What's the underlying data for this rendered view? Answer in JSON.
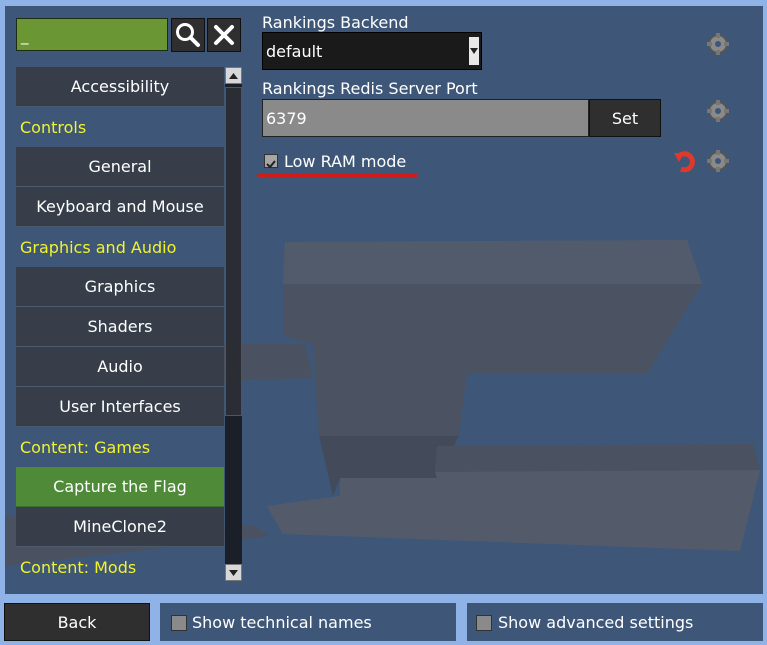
{
  "search": {
    "value": "_"
  },
  "sidebar": {
    "items": [
      {
        "label": "Accessibility",
        "kind": "item"
      },
      {
        "label": "Controls",
        "kind": "section"
      },
      {
        "label": "General",
        "kind": "item"
      },
      {
        "label": "Keyboard and Mouse",
        "kind": "item"
      },
      {
        "label": "Graphics and Audio",
        "kind": "section"
      },
      {
        "label": "Graphics",
        "kind": "item"
      },
      {
        "label": "Shaders",
        "kind": "item"
      },
      {
        "label": "Audio",
        "kind": "item"
      },
      {
        "label": "User Interfaces",
        "kind": "item"
      },
      {
        "label": "Content: Games",
        "kind": "section"
      },
      {
        "label": "Capture the Flag",
        "kind": "item",
        "selected": true
      },
      {
        "label": "MineClone2",
        "kind": "item"
      },
      {
        "label": "Content: Mods",
        "kind": "section"
      }
    ]
  },
  "settings": {
    "rankings_backend": {
      "label": "Rankings Backend",
      "value": "default"
    },
    "redis_port": {
      "label": "Rankings Redis Server Port",
      "value": "6379",
      "button": "Set"
    },
    "low_ram": {
      "label": "Low RAM mode",
      "checked": true
    }
  },
  "footer": {
    "back": "Back",
    "show_technical_names": "Show technical names",
    "show_advanced_settings": "Show advanced settings"
  },
  "colors": {
    "panel": "#3e5778",
    "frame": "#8fb3e6",
    "section_text": "#f3f329",
    "selected_item": "#4e8a37",
    "underline": "#d11b1b"
  },
  "icons": [
    "search-icon",
    "close-icon",
    "gear-icon",
    "reset-icon",
    "check-icon"
  ]
}
